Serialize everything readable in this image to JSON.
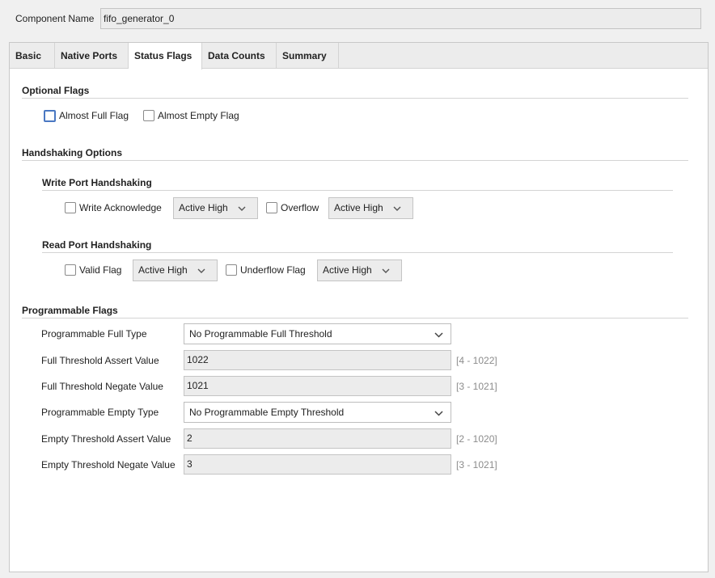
{
  "component": {
    "label": "Component Name",
    "value": "fifo_generator_0"
  },
  "tabs": [
    {
      "label": "Basic",
      "active": false
    },
    {
      "label": "Native Ports",
      "active": false
    },
    {
      "label": "Status Flags",
      "active": true
    },
    {
      "label": "Data Counts",
      "active": false
    },
    {
      "label": "Summary",
      "active": false
    }
  ],
  "optional_flags": {
    "title": "Optional Flags",
    "almost_full": {
      "label": "Almost Full Flag",
      "checked": false
    },
    "almost_empty": {
      "label": "Almost Empty Flag",
      "checked": false
    }
  },
  "handshaking": {
    "title": "Handshaking Options",
    "write": {
      "title": "Write Port Handshaking",
      "write_ack": {
        "label": "Write Acknowledge",
        "checked": false,
        "select": "Active High"
      },
      "overflow": {
        "label": "Overflow",
        "checked": false,
        "select": "Active High"
      }
    },
    "read": {
      "title": "Read Port Handshaking",
      "valid": {
        "label": "Valid Flag",
        "checked": false,
        "select": "Active High"
      },
      "underflow": {
        "label": "Underflow Flag",
        "checked": false,
        "select": "Active High"
      }
    }
  },
  "programmable": {
    "title": "Programmable Flags",
    "full_type": {
      "label": "Programmable Full Type",
      "value": "No Programmable Full Threshold"
    },
    "full_assert": {
      "label": "Full Threshold Assert Value",
      "value": "1022",
      "range": "[4 - 1022]"
    },
    "full_negate": {
      "label": "Full Threshold Negate Value",
      "value": "1021",
      "range": "[3 - 1021]"
    },
    "empty_type": {
      "label": "Programmable Empty Type",
      "value": "No Programmable Empty Threshold"
    },
    "empty_assert": {
      "label": "Empty Threshold Assert Value",
      "value": "2",
      "range": "[2 - 1020]"
    },
    "empty_negate": {
      "label": "Empty Threshold Negate Value",
      "value": "3",
      "range": "[3 - 1021]"
    }
  },
  "icons": {
    "dropdown": "chevron-down-icon"
  }
}
